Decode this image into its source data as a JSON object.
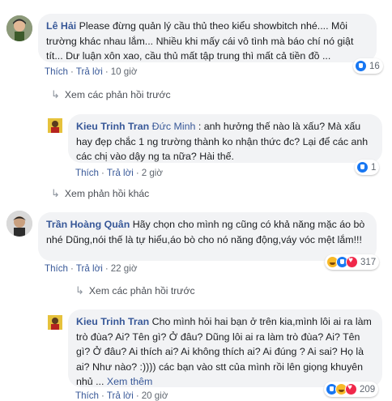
{
  "comments": {
    "c1": {
      "author": "Lê Hải",
      "text": " Please đừng quản lý cầu thủ theo kiểu showbitch nhé.... Môi trường khác nhau lắm... Nhiều khi mấy cái vô tình mà báo chí nó giật tít... Dư luận xôn xao, cầu thủ mất tập trung thì mất cả tiền đồ ...",
      "like": "Thích",
      "reply": "Trả lời",
      "time": "10 giờ",
      "reaction_count": "16",
      "view_prev": "Xem các phản hồi trước"
    },
    "r1": {
      "author": "Kieu Trinh Tran",
      "mention": " Đức Minh",
      "text": " : anh hưởng thế nào là xấu? Mà xấu hay đẹp chắc 1 ng trường thành ko nhận thức đc? Lại để các anh các chị vào dậy ng ta nữa? Hài thế.",
      "like": "Thích",
      "reply": "Trả lời",
      "time": "2 giờ",
      "reaction_count": "1",
      "view_other": "Xem phản hồi khác"
    },
    "c2": {
      "author": "Trần Hoàng Quân",
      "text": " Hãy chọn cho mình ng cũng có khả năng mặc áo bò nhé Dũng,nói thế là tự hiểu,áo bò cho nó năng động,váy vóc mệt lắm!!!",
      "like": "Thích",
      "reply": "Trả lời",
      "time": "22 giờ",
      "reaction_count": "317",
      "view_prev": "Xem các phản hồi trước"
    },
    "r2": {
      "author": "Kieu Trinh Tran",
      "text": " Cho mình hỏi hai bạn ở trên kia,mình lôi ai ra làm trò đùa? Ai? Tên gì? Ở đâu? Dũng lôi ai ra làm trò đùa? Ai? Tên gì? Ở đâu? Ai thích ai? Ai không thích ai? Ai đúng ? Ai sai? Họ là ai? Như nào? :)))) các bạn vào stt của mình rồi lên giọng khuyên nhủ ...",
      "see_more": " Xem thêm",
      "like": "Thích",
      "reply": "Trả lời",
      "time": "20 giờ",
      "reaction_count": "209"
    }
  },
  "colors": {
    "link": "#385898",
    "meta": "#606770",
    "bubble": "#f2f3f5"
  }
}
